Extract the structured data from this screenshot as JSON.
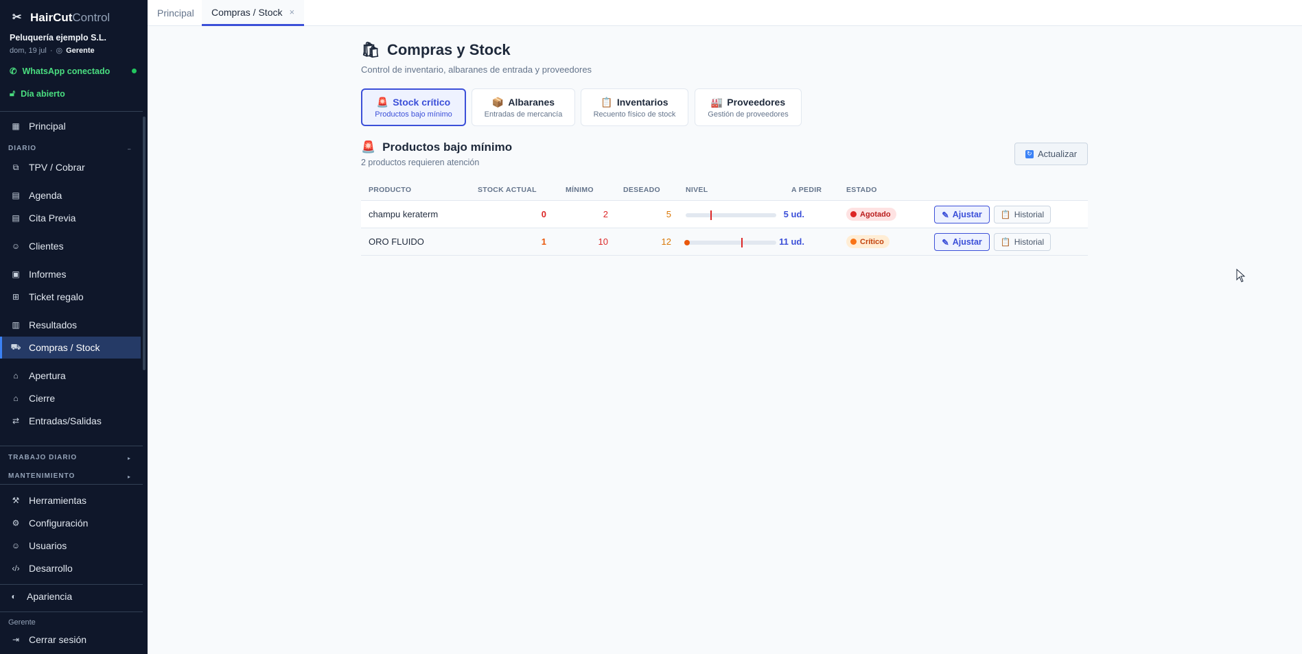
{
  "sidebar": {
    "brand_main": "HairCut",
    "brand_sub": "Control",
    "company": "Peluquería ejemplo S.L.",
    "date": "dom, 19 jul",
    "role": "Gerente",
    "whatsapp": "WhatsApp conectado",
    "day_status": "Día abierto",
    "items": [
      {
        "label": "Principal"
      },
      {
        "label": "TPV / Cobrar"
      },
      {
        "label": "Agenda"
      },
      {
        "label": "Cita Previa"
      },
      {
        "label": "Clientes"
      },
      {
        "label": "Informes"
      },
      {
        "label": "Ticket regalo"
      },
      {
        "label": "Resultados"
      },
      {
        "label": "Compras / Stock"
      },
      {
        "label": "Apertura"
      },
      {
        "label": "Cierre"
      },
      {
        "label": "Entradas/Salidas"
      },
      {
        "label": "Herramientas"
      },
      {
        "label": "Configuración"
      },
      {
        "label": "Usuarios"
      },
      {
        "label": "Desarrollo"
      },
      {
        "label": "Apariencia"
      }
    ],
    "sections": {
      "diario": "DIARIO",
      "trabajo": "TRABAJO DIARIO",
      "mantenimiento": "MANTENIMIENTO"
    },
    "footer_role": "Gerente",
    "logout": "Cerrar sesión"
  },
  "tabs": [
    {
      "label": "Principal"
    },
    {
      "label": "Compras / Stock"
    }
  ],
  "page": {
    "title": "Compras y Stock",
    "subtitle": "Control de inventario, albaranes de entrada y proveedores"
  },
  "subtabs": [
    {
      "title": "Stock crítico",
      "sub": "Productos bajo mínimo"
    },
    {
      "title": "Albaranes",
      "sub": "Entradas de mercancía"
    },
    {
      "title": "Inventarios",
      "sub": "Recuento físico de stock"
    },
    {
      "title": "Proveedores",
      "sub": "Gestión de proveedores"
    }
  ],
  "section": {
    "title": "Productos bajo mínimo",
    "subtitle": "2 productos requieren atención",
    "refresh": "Actualizar"
  },
  "table": {
    "headers": [
      "PRODUCTO",
      "STOCK ACTUAL",
      "MÍNIMO",
      "DESEADO",
      "NIVEL",
      "A PEDIR",
      "ESTADO"
    ],
    "rows": [
      {
        "product": "champu keraterm",
        "stock": "0",
        "min": "2",
        "desired": "5",
        "order": "5 ud.",
        "status": "Agotado",
        "level": 0,
        "min_mark": 0.27
      },
      {
        "product": "ORO FLUIDO",
        "stock": "1",
        "min": "10",
        "desired": "12",
        "order": "11 ud.",
        "status": "Crítico",
        "level": 0.02,
        "min_mark": 0.61
      }
    ],
    "btn_adjust": "Ajustar",
    "btn_history": "Historial"
  },
  "colors": {
    "accent": "#3b4fd8",
    "sidebar_bg": "#0f172a",
    "danger": "#dc2626",
    "warning": "#f97316",
    "success": "#22c55e"
  }
}
